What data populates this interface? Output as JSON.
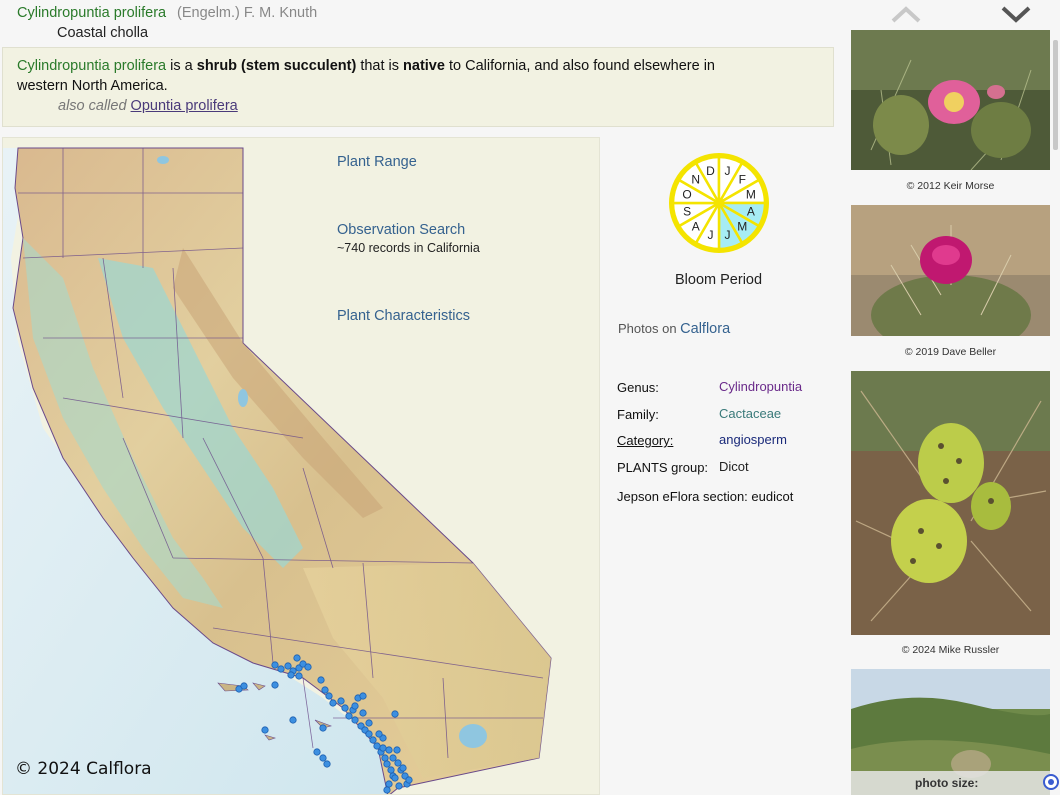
{
  "header": {
    "scientific_name": "Cylindropuntia prolifera",
    "authority": "(Engelm.) F. M. Knuth",
    "common_name": "Coastal cholla"
  },
  "summary": {
    "name": "Cylindropuntia prolifera",
    "text_is_a": "is a",
    "habit": "shrub (stem succulent)",
    "text_that_is": "that is",
    "status": "native",
    "text_rest": "to California, and also found elsewhere in western North America.",
    "also_called_label": "also called",
    "also_called_name": "Opuntia prolifera"
  },
  "map_panel": {
    "plant_range": "Plant Range",
    "observation_search": "Observation Search",
    "observation_count": "~740 records in California",
    "plant_characteristics": "Plant Characteristics",
    "copyright": "© 2024 Calflora"
  },
  "bloom": {
    "label": "Bloom Period",
    "months": [
      "J",
      "F",
      "M",
      "A",
      "M",
      "J",
      "J",
      "A",
      "S",
      "O",
      "N",
      "D"
    ],
    "blooming": [
      false,
      false,
      false,
      true,
      true,
      true,
      false,
      false,
      false,
      false,
      false,
      false
    ],
    "colors": {
      "ring": "#f4e400",
      "bloom": "#a6ecf4",
      "face": "#ffffff"
    }
  },
  "photos_on": {
    "label": "Photos on",
    "link": "Calflora"
  },
  "taxonomy": {
    "genus_label": "Genus:",
    "genus": "Cylindropuntia",
    "family_label": "Family:",
    "family": "Cactaceae",
    "category_label": "Category:",
    "category": "angiosperm",
    "plants_group_label": "PLANTS group:",
    "plants_group": "Dicot",
    "jepson_label": "Jepson eFlora section:",
    "jepson": "eudicot"
  },
  "photos": [
    {
      "credit": "© 2012 Keir Morse",
      "subject": "cholla flowering pink"
    },
    {
      "credit": "© 2019 Dave Beller",
      "subject": "magenta flower on spiny cactus"
    },
    {
      "credit": "© 2024 Mike Russler",
      "subject": "green fruits among spines"
    },
    {
      "credit": "",
      "subject": "hillside landscape"
    }
  ],
  "photo_size": {
    "label": "photo size:"
  },
  "icons": {
    "prev": "chevron-up-icon",
    "next": "chevron-down-icon"
  },
  "observation_points": "blue dots along southern California coast and Channel Islands"
}
